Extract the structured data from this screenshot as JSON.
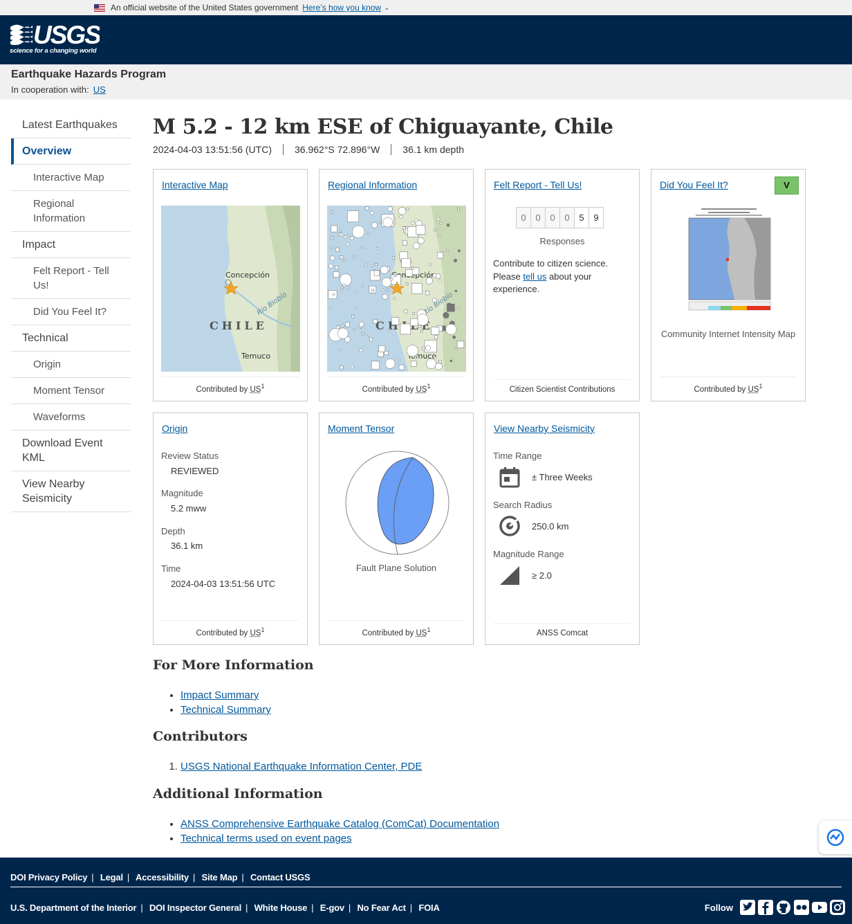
{
  "gov_banner": {
    "text": "An official website of the United States government",
    "link": "Here’s how you know"
  },
  "logo": {
    "text": "USGS",
    "tagline": "science for a changing world"
  },
  "program": {
    "title": "Earthquake Hazards Program",
    "coop_label": "In cooperation with:",
    "coop_link": "US"
  },
  "sidebar": {
    "items": [
      {
        "label": "Latest Earthquakes"
      },
      {
        "label": "Overview"
      },
      {
        "label": "Interactive Map"
      },
      {
        "label": "Regional Information"
      },
      {
        "label": "Impact"
      },
      {
        "label": "Felt Report - Tell Us!"
      },
      {
        "label": "Did You Feel It?"
      },
      {
        "label": "Technical"
      },
      {
        "label": "Origin"
      },
      {
        "label": "Moment Tensor"
      },
      {
        "label": "Waveforms"
      },
      {
        "label": "Download Event KML"
      },
      {
        "label": "View Nearby Seismicity"
      }
    ]
  },
  "event": {
    "title": "M 5.2 - 12 km ESE of Chiguayante, Chile",
    "time": "2024-04-03 13:51:56 (UTC)",
    "coords": "36.962°S 72.896°W",
    "depth": "36.1 km depth"
  },
  "cards": {
    "contributed_by": "Contributed by",
    "contributor_abbr": "US",
    "contributor_sup": "1",
    "interactive_map": {
      "title": "Interactive Map",
      "label_concepcion": "Concepción",
      "label_chile": "CHILE",
      "label_temuco": "Temuco",
      "label_river": "Río Biobío"
    },
    "regional": {
      "title": "Regional Information",
      "label_concepcion": "Concepción",
      "label_chile": "CHILE",
      "label_temuco": "Temuco",
      "label_river": "Río Biobío"
    },
    "felt_report": {
      "title": "Felt Report - Tell Us!",
      "digits": [
        "0",
        "0",
        "0",
        "0",
        "5",
        "9"
      ],
      "responses_label": "Responses",
      "text_before": "Contribute to citizen science. Please ",
      "text_link": "tell us",
      "text_after": " about your experience.",
      "footer": "Citizen Scientist Contributions"
    },
    "dyfi": {
      "title": "Did You Feel It?",
      "mmi": "V",
      "caption": "Community Internet Intensity Map"
    },
    "origin": {
      "title": "Origin",
      "review_status_label": "Review Status",
      "review_status": "REVIEWED",
      "magnitude_label": "Magnitude",
      "magnitude": "5.2 mww",
      "depth_label": "Depth",
      "depth": "36.1 km",
      "time_label": "Time",
      "time": "2024-04-03 13:51:56 UTC"
    },
    "moment_tensor": {
      "title": "Moment Tensor",
      "caption": "Fault Plane Solution",
      "beachball_color": "#6b9ef5"
    },
    "seismicity": {
      "title": "View Nearby Seismicity",
      "time_range_label": "Time Range",
      "time_range": "± Three Weeks",
      "radius_label": "Search Radius",
      "radius": "250.0 km",
      "mag_range_label": "Magnitude Range",
      "mag_range": "≥ 2.0",
      "footer": "ANSS Comcat"
    }
  },
  "sections": {
    "more_info": {
      "heading": "For More Information",
      "links": [
        "Impact Summary",
        "Technical Summary"
      ]
    },
    "contributors": {
      "heading": "Contributors",
      "links": [
        "USGS National Earthquake Information Center, PDE"
      ]
    },
    "additional": {
      "heading": "Additional Information",
      "links": [
        "ANSS Comprehensive Earthquake Catalog (ComCat) Documentation",
        "Technical terms used on event pages"
      ]
    }
  },
  "footer": {
    "row1": [
      "DOI Privacy Policy",
      "Legal",
      "Accessibility",
      "Site Map",
      "Contact USGS"
    ],
    "row2": [
      "U.S. Department of the Interior",
      "DOI Inspector General",
      "White House",
      "E-gov",
      "No Fear Act",
      "FOIA"
    ],
    "follow_label": "Follow",
    "social_icons": [
      "twitter-icon",
      "facebook-icon",
      "github-icon",
      "flickr-icon",
      "youtube-icon",
      "instagram-icon"
    ]
  },
  "colors": {
    "header_bg": "#00264c",
    "accent": "#0b5394",
    "mmi_v": "#7ac36a",
    "star": "#f5a623"
  }
}
